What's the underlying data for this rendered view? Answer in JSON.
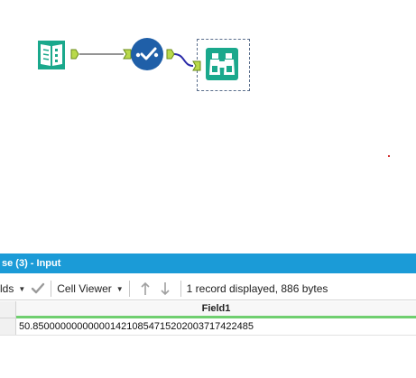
{
  "workflow": {
    "tools": [
      {
        "name": "input-data",
        "icon": "book-icon",
        "color": "#1aa88c"
      },
      {
        "name": "select-tool",
        "icon": "check-circle-icon",
        "color": "#1f5fa8"
      },
      {
        "name": "browse-tool",
        "icon": "binoculars-icon",
        "color": "#1aa88c"
      }
    ],
    "wire_color": "#2a2aa8"
  },
  "results": {
    "title": "se (3) - Input",
    "titlebar_color": "#1b9bd7",
    "toolbar": {
      "fields_label": "lds",
      "cell_viewer_label": "Cell Viewer",
      "record_info": "1 record displayed, 886 bytes"
    },
    "grid": {
      "columns": [
        "Field1"
      ],
      "rows": [
        [
          "50.8500000000000014210854715202003717422485"
        ]
      ]
    }
  }
}
